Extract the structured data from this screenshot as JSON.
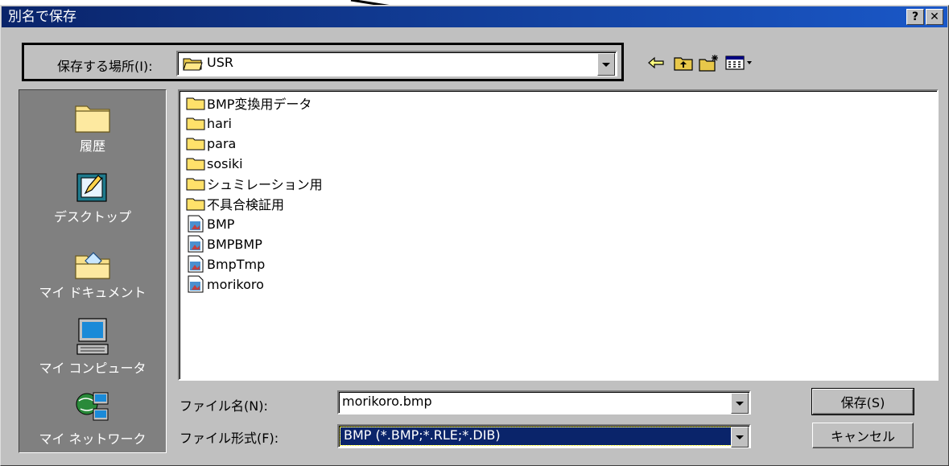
{
  "window": {
    "title": "別名で保存"
  },
  "titlebar_buttons": {
    "help": "?",
    "close": "✕"
  },
  "location": {
    "label": "保存する場所(I):",
    "value": "USR"
  },
  "toolbar": {
    "back_icon": "back-arrow-icon",
    "up_icon": "up-one-level-icon",
    "new_folder_icon": "new-folder-icon",
    "views_icon": "views-menu-icon"
  },
  "places": [
    {
      "label": "履歴",
      "icon": "history-folder-icon"
    },
    {
      "label": "デスクトップ",
      "icon": "desktop-icon"
    },
    {
      "label": "マイ ドキュメント",
      "icon": "my-documents-icon"
    },
    {
      "label": "マイ コンピュータ",
      "icon": "my-computer-icon"
    },
    {
      "label": "マイ ネットワーク",
      "icon": "my-network-icon"
    }
  ],
  "files": [
    {
      "name": "BMP変換用データ",
      "type": "folder"
    },
    {
      "name": "hari",
      "type": "folder"
    },
    {
      "name": "para",
      "type": "folder"
    },
    {
      "name": "sosiki",
      "type": "folder"
    },
    {
      "name": "シュミレーション用",
      "type": "folder"
    },
    {
      "name": "不具合検証用",
      "type": "folder"
    },
    {
      "name": "BMP",
      "type": "file"
    },
    {
      "name": "BMPBMP",
      "type": "file"
    },
    {
      "name": "BmpTmp",
      "type": "file"
    },
    {
      "name": "morikoro",
      "type": "file"
    }
  ],
  "filename": {
    "label": "ファイル名(N):",
    "value": "morikoro.bmp"
  },
  "filetype": {
    "label": "ファイル形式(F):",
    "value": "BMP (*.BMP;*.RLE;*.DIB)"
  },
  "buttons": {
    "save": "保存(S)",
    "cancel": "キャンセル"
  }
}
